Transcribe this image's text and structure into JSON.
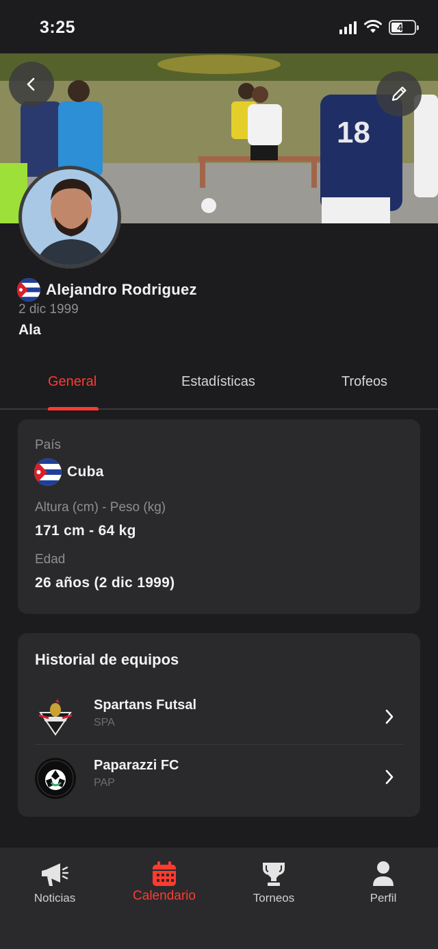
{
  "status_bar": {
    "time": "3:25",
    "battery": "42"
  },
  "profile": {
    "name": "Alejandro Rodriguez",
    "birth_date": "2 dic 1999",
    "position": "Ala"
  },
  "tabs": [
    {
      "label": "General",
      "active": true
    },
    {
      "label": "Estadísticas",
      "active": false
    },
    {
      "label": "Trofeos",
      "active": false
    }
  ],
  "general": {
    "country_label": "País",
    "country_value": "Cuba",
    "size_label": "Altura (cm) - Peso (kg)",
    "size_value": "171 cm - 64 kg",
    "age_label": "Edad",
    "age_value": "26 años (2 dic 1999)"
  },
  "teams": {
    "title": "Historial de equipos",
    "items": [
      {
        "name": "Spartans Futsal",
        "abbr": "SPA"
      },
      {
        "name": "Paparazzi FC",
        "abbr": "PAP"
      }
    ]
  },
  "bottom_nav": [
    {
      "label": "Noticias",
      "icon": "megaphone-icon",
      "active": false
    },
    {
      "label": "Calendario",
      "icon": "calendar-icon",
      "active": true
    },
    {
      "label": "Torneos",
      "icon": "trophy-icon",
      "active": false
    },
    {
      "label": "Perfil",
      "icon": "user-icon",
      "active": false
    }
  ],
  "colors": {
    "accent": "#ff3b30",
    "background": "#1c1c1e",
    "card": "#2a2a2c"
  }
}
